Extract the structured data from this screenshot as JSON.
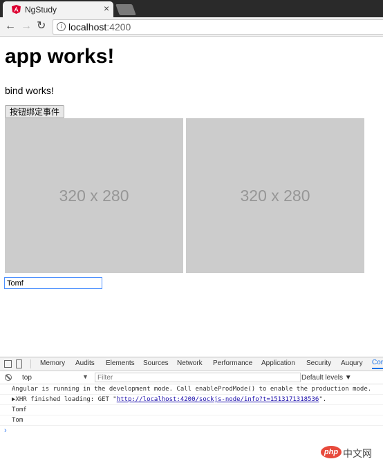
{
  "browser": {
    "tab_title": "NgStudy",
    "tab_close": "×",
    "url_host": "localhost",
    "url_port": ":4200",
    "nav": {
      "back": "←",
      "forward": "→",
      "reload": "↻"
    }
  },
  "page": {
    "heading": "app works!",
    "bind_text": "bind works!",
    "button_label": "按钮绑定事件",
    "placeholders": [
      "320 x 280",
      "320 x 280"
    ],
    "input_value": "Tomf"
  },
  "devtools": {
    "tabs": [
      "Memory",
      "Audits",
      "Elements",
      "Sources",
      "Network",
      "Performance",
      "Application",
      "Security",
      "Auqury",
      "Cor"
    ],
    "context": "top",
    "context_arrow": "▼",
    "filter_placeholder": "Filter",
    "levels": "Default levels ▼",
    "logs": {
      "line1": "Angular is running in the development mode. Call enableProdMode() to enable the production mode.",
      "line2_prefix": "▶XHR finished loading: GET \"",
      "line2_link": "http://localhost:4200/sockjs-node/info?t=1513171318536",
      "line2_suffix": "\".",
      "line3": "Tomf",
      "line4": "Tom"
    },
    "prompt": "›"
  },
  "watermark": {
    "badge": "php",
    "text": "中文网"
  },
  "colors": {
    "accent": "#1a73e8",
    "placeholder_bg": "#cccccc",
    "watermark_red": "#e84a3c"
  }
}
